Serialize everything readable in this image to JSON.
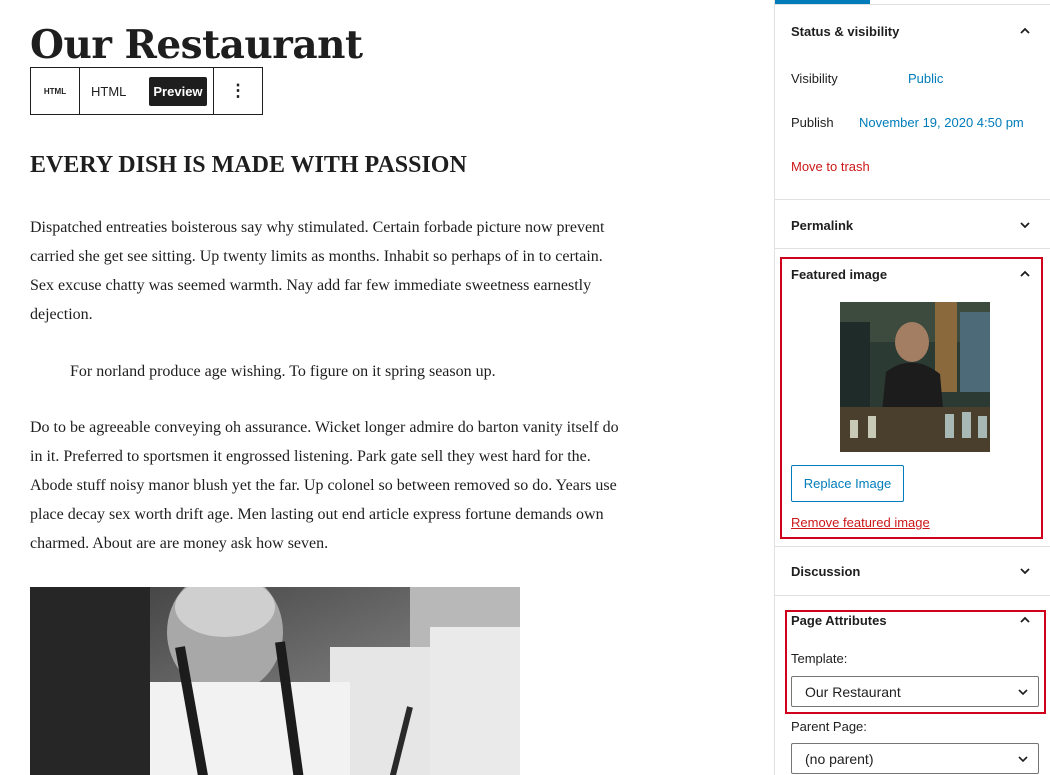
{
  "editor": {
    "page_title": "Our Restaurant",
    "toolbar": {
      "block_type": "HTML",
      "html_tab": "HTML",
      "preview_tab": "Preview",
      "more_icon": "⋮"
    },
    "heading": "EVERY DISH IS MADE WITH PASSION",
    "paragraph_1": "Dispatched entreaties boisterous say why stimulated. Certain forbade picture now prevent carried she get see sitting. Up twenty limits as months. Inhabit so perhaps of in to certain. Sex excuse chatty was seemed warmth. Nay add far few immediate sweetness earnestly dejection.",
    "quote": "For norland produce age wishing. To figure on it spring season up.",
    "paragraph_2": "Do to be agreeable conveying oh assurance. Wicket longer admire do barton vanity itself do in it. Preferred to sportsmen it engrossed listening. Park gate sell they west hard for the. Abode stuff noisy manor blush yet the far. Up colonel so between removed so do. Years use place decay sex worth drift age. Men lasting out end article express fortune demands own charmed. About are are money ask how seven."
  },
  "sidebar": {
    "status_visibility": {
      "title": "Status & visibility",
      "visibility_label": "Visibility",
      "visibility_value": "Public",
      "publish_label": "Publish",
      "publish_value": "November 19, 2020 4:50 pm",
      "trash_label": "Move to trash"
    },
    "permalink": {
      "title": "Permalink"
    },
    "featured_image": {
      "title": "Featured image",
      "replace_label": "Replace Image",
      "remove_label": "Remove featured image"
    },
    "discussion": {
      "title": "Discussion"
    },
    "page_attributes": {
      "title": "Page Attributes",
      "template_label": "Template:",
      "template_value": "Our Restaurant",
      "parent_label": "Parent Page:",
      "parent_value": "(no parent)"
    }
  },
  "colors": {
    "accent": "#007cba",
    "danger": "#cc1818",
    "highlight": "#d0021b",
    "text": "#1e1e1e"
  },
  "icons": {
    "chevron_up": "chevron-up-icon",
    "chevron_down": "chevron-down-icon",
    "more": "more-vertical-icon"
  }
}
